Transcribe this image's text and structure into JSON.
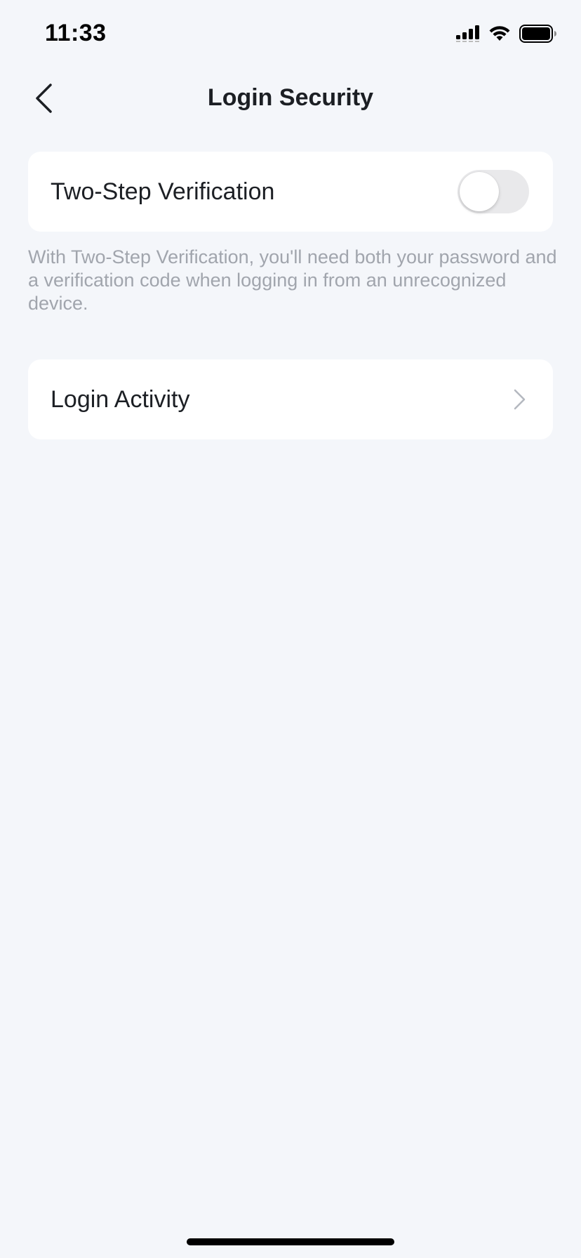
{
  "status_bar": {
    "time": "11:33",
    "icons": [
      "cellular-signal-icon",
      "wifi-icon",
      "battery-icon"
    ]
  },
  "nav": {
    "title": "Login Security",
    "back_icon": "chevron-left-icon"
  },
  "two_step": {
    "label": "Two-Step Verification",
    "enabled": false,
    "description": "With Two-Step Verification, you'll need both your password and a verification code when logging in from an unrecognized device."
  },
  "login_activity": {
    "label": "Login Activity",
    "icon": "chevron-right-icon"
  },
  "colors": {
    "background": "#f4f6fa",
    "card": "#ffffff",
    "toggle_off": "#e9e9eb",
    "secondary_text": "#a1a5ad",
    "primary_text": "#1c1f24"
  }
}
